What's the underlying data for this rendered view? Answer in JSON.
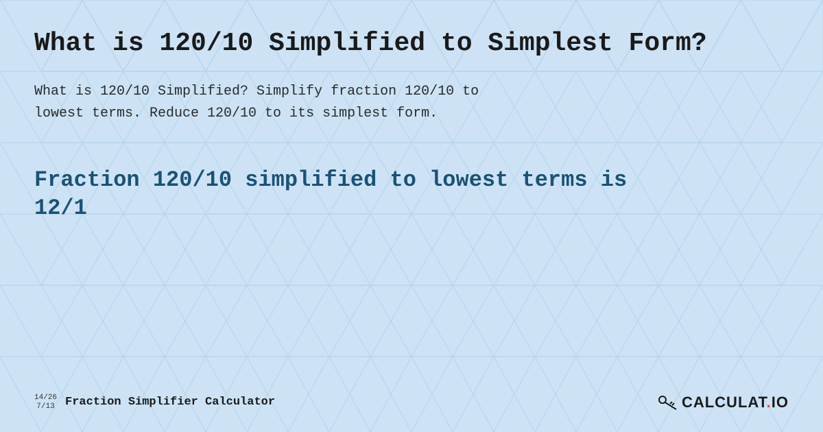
{
  "page": {
    "title": "What is 120/10 Simplified to Simplest Form?",
    "description": "What is 120/10 Simplified? Simplify fraction 120/10 to lowest terms. Reduce 120/10 to its simplest form.",
    "result_title": "Fraction 120/10 simplified to lowest terms is 12/1",
    "footer": {
      "fraction1": "14/26",
      "fraction2": "7/13",
      "label": "Fraction Simplifier Calculator",
      "logo_text": "CALCULAT.IO"
    },
    "background_color": "#cce0f5",
    "accent_color": "#1a5276"
  }
}
